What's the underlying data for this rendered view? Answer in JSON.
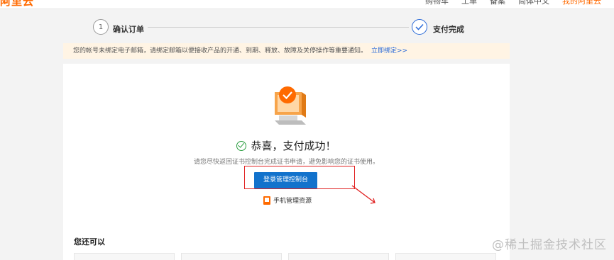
{
  "topbar": {
    "brand": "阿里云",
    "nav": [
      "购物车",
      "工单",
      "备案",
      "简体中文",
      "我的阿里云"
    ]
  },
  "steps": [
    {
      "number": "1",
      "label": "确认订单",
      "state": "inactive"
    },
    {
      "number": "",
      "label": "支付完成",
      "state": "done"
    }
  ],
  "notice": {
    "text": "您的帐号未绑定电子邮箱，请绑定邮箱以便接收产品的开通、到期、释放、故障及关停操作等重要通知。",
    "link": "立即绑定>>"
  },
  "result": {
    "title": "恭喜，支付成功！",
    "subtitle": "请您尽快返回证书控制台完成证书申请，避免影响您的证书使用。",
    "button": "登录管理控制台",
    "mobile_link": "手机管理资源"
  },
  "more": {
    "title": "您还可以"
  },
  "watermark": "@稀土掘金技术社区",
  "colors": {
    "accent": "#ff6a00",
    "primary": "#1272cc",
    "success": "#2a9d3f",
    "highlight": "#e02020"
  }
}
